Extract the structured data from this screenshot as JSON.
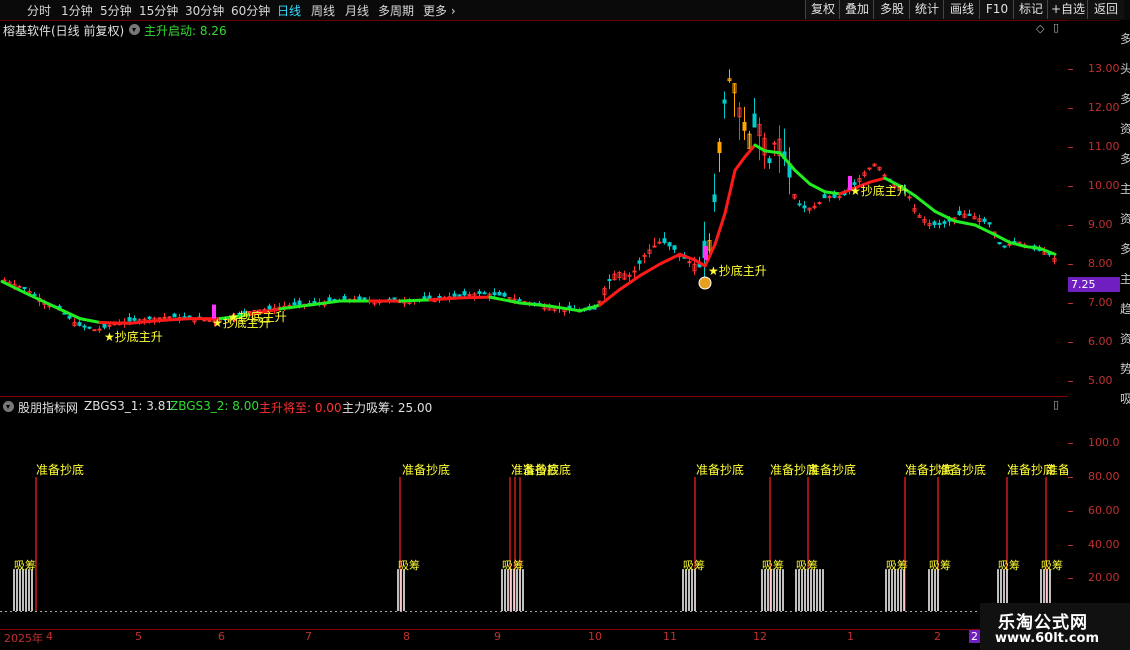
{
  "toolbar": {
    "periods": [
      "分时",
      "1分钟",
      "5分钟",
      "15分钟",
      "30分钟",
      "60分钟",
      "日线",
      "周线",
      "月线",
      "多周期",
      "更多"
    ],
    "active_period": "日线",
    "right_buttons": [
      "复权",
      "叠加",
      "多股",
      "统计",
      "画线",
      "F10",
      "标记",
      "+自选",
      "返回"
    ]
  },
  "chart_header": {
    "title": "榕基软件(日线 前复权)",
    "indicator_label": "主升启动: 8.26"
  },
  "lower_header": {
    "indicator_name": "股朋指标网",
    "items": [
      {
        "text": "ZBGS3_1: 3.81",
        "color": "#e0e0e0"
      },
      {
        "text": "ZBGS3_2: 8.00",
        "color": "#33dd33"
      },
      {
        "text": "主升将至: 0.00",
        "color": "#ff3333"
      },
      {
        "text": "主力吸筹: 25.00",
        "color": "#e0e0e0"
      }
    ]
  },
  "price_axis": {
    "labels": [
      "13.00",
      "12.00",
      "11.00",
      "10.00",
      "9.00",
      "8.00",
      "7.00",
      "6.00",
      "5.00"
    ],
    "current_price": "7.25"
  },
  "indicator_axis": {
    "labels": [
      "100.0",
      "80.00",
      "60.00",
      "40.00",
      "20.00"
    ]
  },
  "date_axis": {
    "labels": [
      "2025年",
      "4",
      "5",
      "6",
      "7",
      "8",
      "9",
      "10",
      "11",
      "12",
      "1",
      "2",
      "2"
    ]
  },
  "signals": {
    "buy_label": "★抄底主升",
    "prepare_label": "准备抄底",
    "absorb_label": "吸筹"
  },
  "right_strip_text": [
    "多",
    "头",
    "多",
    "资",
    "多",
    "主",
    "资",
    "多",
    "主",
    "趋",
    "资",
    "势",
    "吸"
  ],
  "watermark": {
    "title": "乐淘公式网",
    "url": "www.60lt.com"
  },
  "colors": {
    "up_candle": "#ff3333",
    "down_candle": "#00cccc",
    "line_up": "#ff1a1a",
    "line_down": "#22ee22",
    "signal_yellow": "#ffff33",
    "orange_candle": "#ffa500",
    "magenta": "#ff33ff",
    "axis_red": "#c03030"
  }
}
